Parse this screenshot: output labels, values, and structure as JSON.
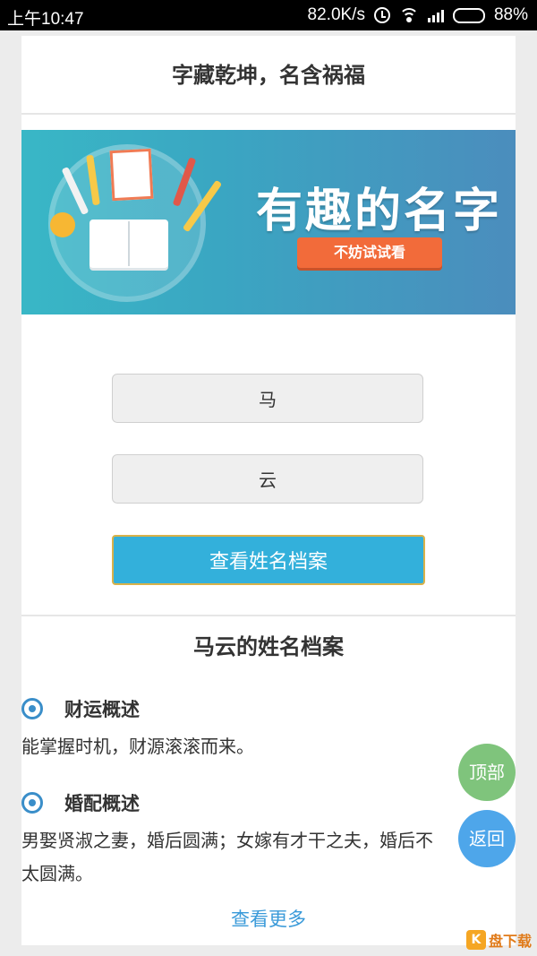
{
  "status_bar": {
    "time": "上午10:47",
    "net_speed": "82.0K/s",
    "battery_level": "88%"
  },
  "header": {
    "title": "字藏乾坤，名含祸福"
  },
  "banner": {
    "headline": "有趣的名字",
    "button_label": "不妨试试看"
  },
  "form": {
    "surname_value": "马",
    "given_name_value": "云",
    "submit_label": "查看姓名档案"
  },
  "result": {
    "title": "马云的姓名档案",
    "sections": [
      {
        "heading": "财运概述",
        "text_lines": [
          "能掌握时机，财源滚滚而来。"
        ]
      },
      {
        "heading": "婚配概述",
        "text_lines": [
          "男娶贤淑之妻，婚后圆满；女嫁有才干之夫，婚后不",
          "太圆满。"
        ]
      }
    ],
    "more_label": "查看更多"
  },
  "floating": {
    "top_label": "顶部",
    "back_label": "返回"
  },
  "watermark": {
    "text": "盘下载"
  },
  "colors": {
    "accent": "#33b0db",
    "link": "#3a9ad9",
    "fab_top": "#7fc47c",
    "fab_back": "#4ea6ea"
  }
}
